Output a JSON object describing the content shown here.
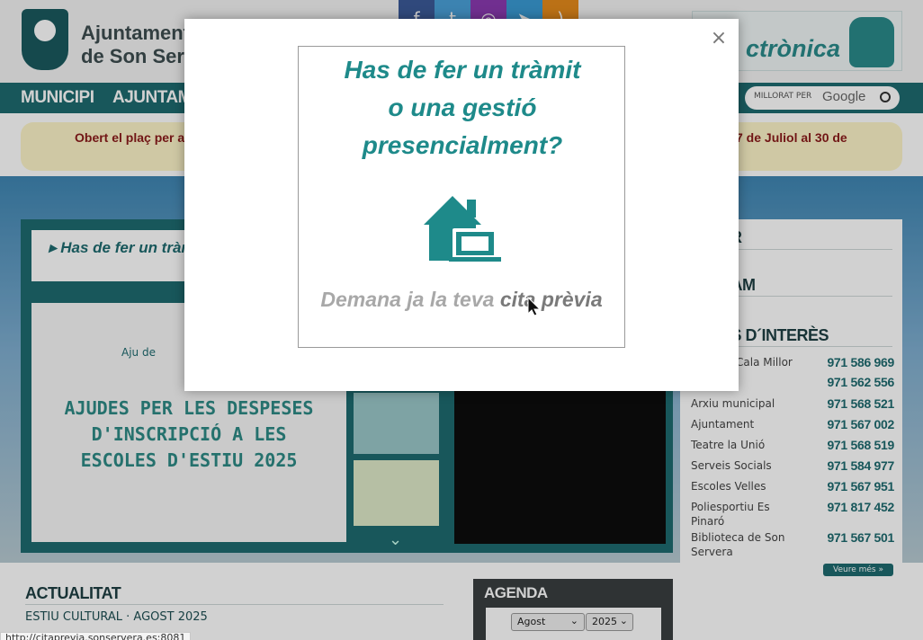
{
  "header": {
    "logo_line1": "Ajuntament",
    "logo_line2": "de Son Serv",
    "social_icons": [
      "facebook-icon",
      "twitter-icon",
      "instagram-icon",
      "telegram-icon",
      "rss-icon"
    ],
    "eadmin_text": "ctrònica"
  },
  "nav": {
    "items": [
      "MUNICIPI",
      "AJUNTAMEN"
    ]
  },
  "search": {
    "label": "MILLORAT PER",
    "brand": "Google"
  },
  "notice": {
    "left": "Obert el plaç per a",
    "right": "7 de Juliol al 30 de"
  },
  "slider": {
    "title": "Has de fer un tràm",
    "poster_text": "AJUDES PER LES DESPESES D'INSCRIPCIÓ A LES ESCOLES D'ESTIU 2025",
    "poster_logo": "Aju de"
  },
  "sidebar": {
    "heads": [
      "R",
      "RAM",
      "NS D´INTERÈS"
    ],
    "phones": [
      {
        "name": "Cala Millor",
        "number": "971 586 969"
      },
      {
        "name": "",
        "number": "971 562 556"
      },
      {
        "name": "Arxiu municipal",
        "number": "971 568 521"
      },
      {
        "name": "Ajuntament",
        "number": "971 567 002"
      },
      {
        "name": "Teatre la Unió",
        "number": "971 568 519"
      },
      {
        "name": "Serveis Socials",
        "number": "971 584 977"
      },
      {
        "name": "Escoles Velles",
        "number": "971 567 951"
      },
      {
        "name": "Poliesportiu Es Pinaró",
        "number": "971 817 452"
      },
      {
        "name": "Biblioteca de Son Servera",
        "number": "971 567 501"
      }
    ],
    "more_button": "Veure més »"
  },
  "news": {
    "heading": "ACTUALITAT",
    "item": "ESTIU CULTURAL · AGOST 2025"
  },
  "agenda": {
    "heading": "AGENDA",
    "month": "Agost",
    "year": "2025"
  },
  "statusbar": {
    "url": "http://citaprevia.sonservera.es:8081"
  },
  "modal": {
    "close_symbol": "×",
    "question_lines": [
      "Has de fer un tràmit",
      "o una gestió",
      "presencialment?"
    ],
    "cta_prefix": "Demana ja la teva",
    "cta_highlight": "cita prèvia",
    "accent_color": "#1e8a8a"
  }
}
